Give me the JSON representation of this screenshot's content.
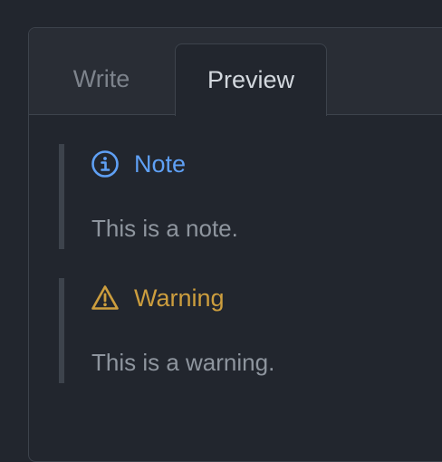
{
  "tabs": {
    "write_label": "Write",
    "preview_label": "Preview",
    "active": "Preview"
  },
  "alerts": [
    {
      "type": "note",
      "icon": "info-icon",
      "title": "Note",
      "body": "This is a note.",
      "color": "#5fa0f5"
    },
    {
      "type": "warning",
      "icon": "warning-icon",
      "title": "Warning",
      "body": "This is a warning.",
      "color": "#cd9e3e"
    }
  ]
}
